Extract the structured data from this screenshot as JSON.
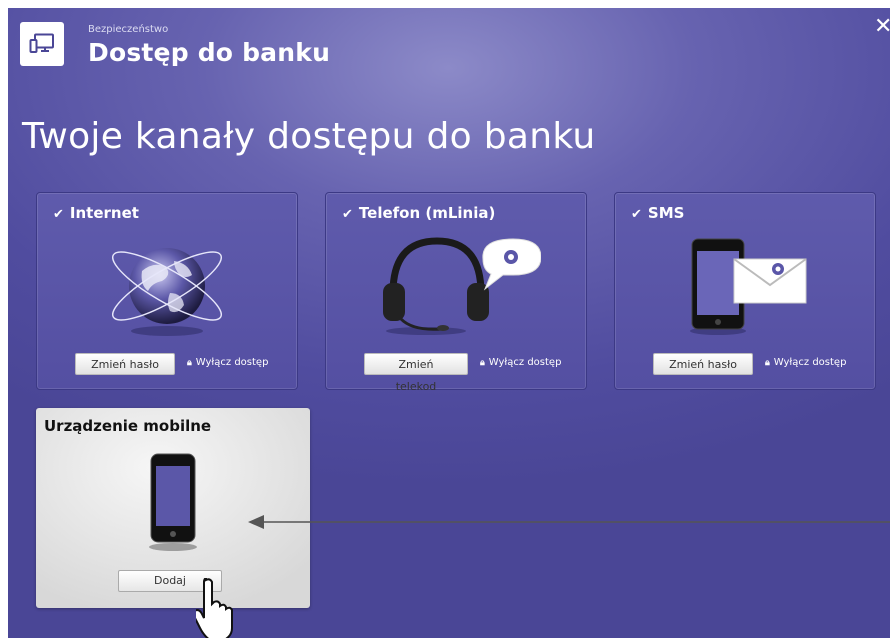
{
  "header": {
    "breadcrumb": "Bezpieczeństwo",
    "title": "Dostęp do banku",
    "close_label": "✕"
  },
  "page_title": "Twoje kanały dostępu do banku",
  "cards": [
    {
      "title": "Internet",
      "check": "✔",
      "button": "Zmień hasło",
      "disable": "Wyłącz dostęp",
      "icon": "globe-icon"
    },
    {
      "title": "Telefon (mLinia)",
      "check": "✔",
      "button": "Zmień telekod",
      "disable": "Wyłącz dostęp",
      "icon": "headset-icon"
    },
    {
      "title": "SMS",
      "check": "✔",
      "button": "Zmień hasło",
      "disable": "Wyłącz dostęp",
      "icon": "phone-envelope-icon"
    }
  ],
  "mobile": {
    "title": "Urządzenie mobilne",
    "button": "Dodaj",
    "icon": "smartphone-icon"
  },
  "colors": {
    "background": "#5a56a8",
    "card": "#5a56a8",
    "mobile_card": "#e4e4e4"
  }
}
